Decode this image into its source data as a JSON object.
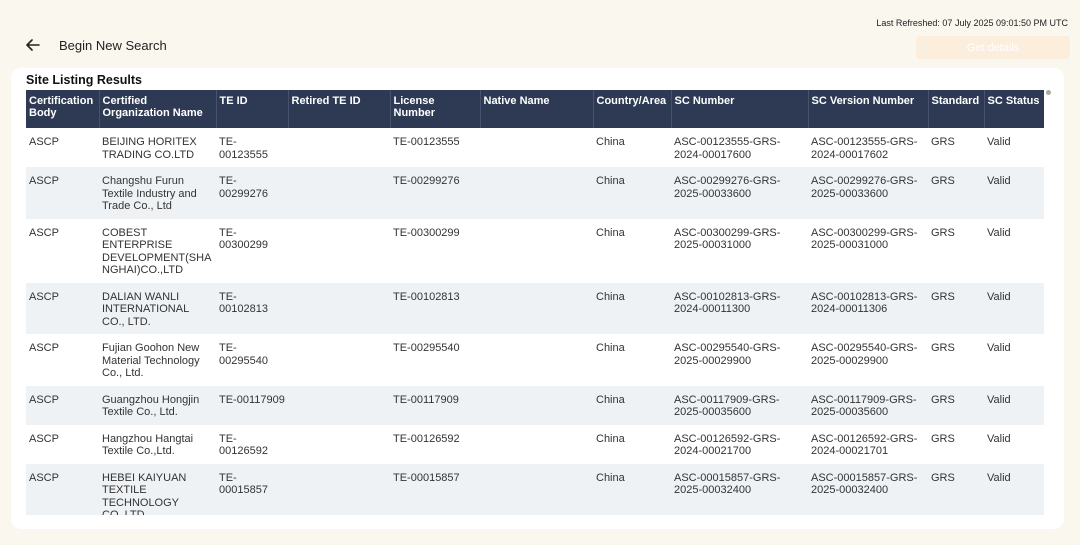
{
  "header": {
    "last_refreshed": "Last Refreshed: 07 July 2025 09:01:50 PM UTC",
    "back_title": "Begin New Search",
    "get_details_label": "Get details"
  },
  "panel": {
    "title": "Site Listing Results"
  },
  "table": {
    "columns": [
      "Certification Body",
      "Certified Organization Name",
      "TE ID",
      "Retired TE ID",
      "License Number",
      "Native Name",
      "Country/Area",
      "SC Number",
      "SC Version Number",
      "Standard",
      "SC Status"
    ],
    "rows": [
      [
        "ASCP",
        "BEIJING HORITEX TRADING CO.LTD",
        "TE-00123555",
        "",
        "TE-00123555",
        "",
        "China",
        "ASC-00123555-GRS-2024-00017600",
        "ASC-00123555-GRS-2024-00017602",
        "GRS",
        "Valid"
      ],
      [
        "ASCP",
        "Changshu Furun Textile Industry and Trade Co., Ltd",
        "TE-00299276",
        "",
        "TE-00299276",
        "",
        "China",
        "ASC-00299276-GRS-2025-00033600",
        "ASC-00299276-GRS-2025-00033600",
        "GRS",
        "Valid"
      ],
      [
        "ASCP",
        "COBEST ENTERPRISE DEVELOPMENT(SHANGHAI)CO.,LTD",
        "TE-00300299",
        "",
        "TE-00300299",
        "",
        "China",
        "ASC-00300299-GRS-2025-00031000",
        "ASC-00300299-GRS-2025-00031000",
        "GRS",
        "Valid"
      ],
      [
        "ASCP",
        "DALIAN WANLI INTERNATIONAL CO., LTD.",
        "TE-00102813",
        "",
        "TE-00102813",
        "",
        "China",
        "ASC-00102813-GRS-2024-00011300",
        "ASC-00102813-GRS-2024-00011306",
        "GRS",
        "Valid"
      ],
      [
        "ASCP",
        "Fujian Goohon New Material Technology Co., Ltd.",
        "TE-00295540",
        "",
        "TE-00295540",
        "",
        "China",
        "ASC-00295540-GRS-2025-00029900",
        "ASC-00295540-GRS-2025-00029900",
        "GRS",
        "Valid"
      ],
      [
        "ASCP",
        "Guangzhou Hongjin Textile Co., Ltd.",
        "TE-00117909",
        "",
        "TE-00117909",
        "",
        "China",
        "ASC-00117909-GRS-2025-00035600",
        "ASC-00117909-GRS-2025-00035600",
        "GRS",
        "Valid"
      ],
      [
        "ASCP",
        "Hangzhou Hangtai Textile Co.,Ltd.",
        "TE-00126592",
        "",
        "TE-00126592",
        "",
        "China",
        "ASC-00126592-GRS-2024-00021700",
        "ASC-00126592-GRS-2024-00021701",
        "GRS",
        "Valid"
      ],
      [
        "ASCP",
        "HEBEI KAIYUAN TEXTILE TECHNOLOGY CO.,LTD",
        "TE-00015857",
        "",
        "TE-00015857",
        "",
        "China",
        "ASC-00015857-GRS-2025-00032400",
        "ASC-00015857-GRS-2025-00032400",
        "GRS",
        "Valid"
      ]
    ]
  },
  "icons": {
    "back": "arrow-left-icon"
  },
  "colors": {
    "header_bg": "#2e3a54",
    "alt_row": "#eef2f5",
    "page_bg": "#faf7ef",
    "button_bg": "#fbeedd"
  }
}
